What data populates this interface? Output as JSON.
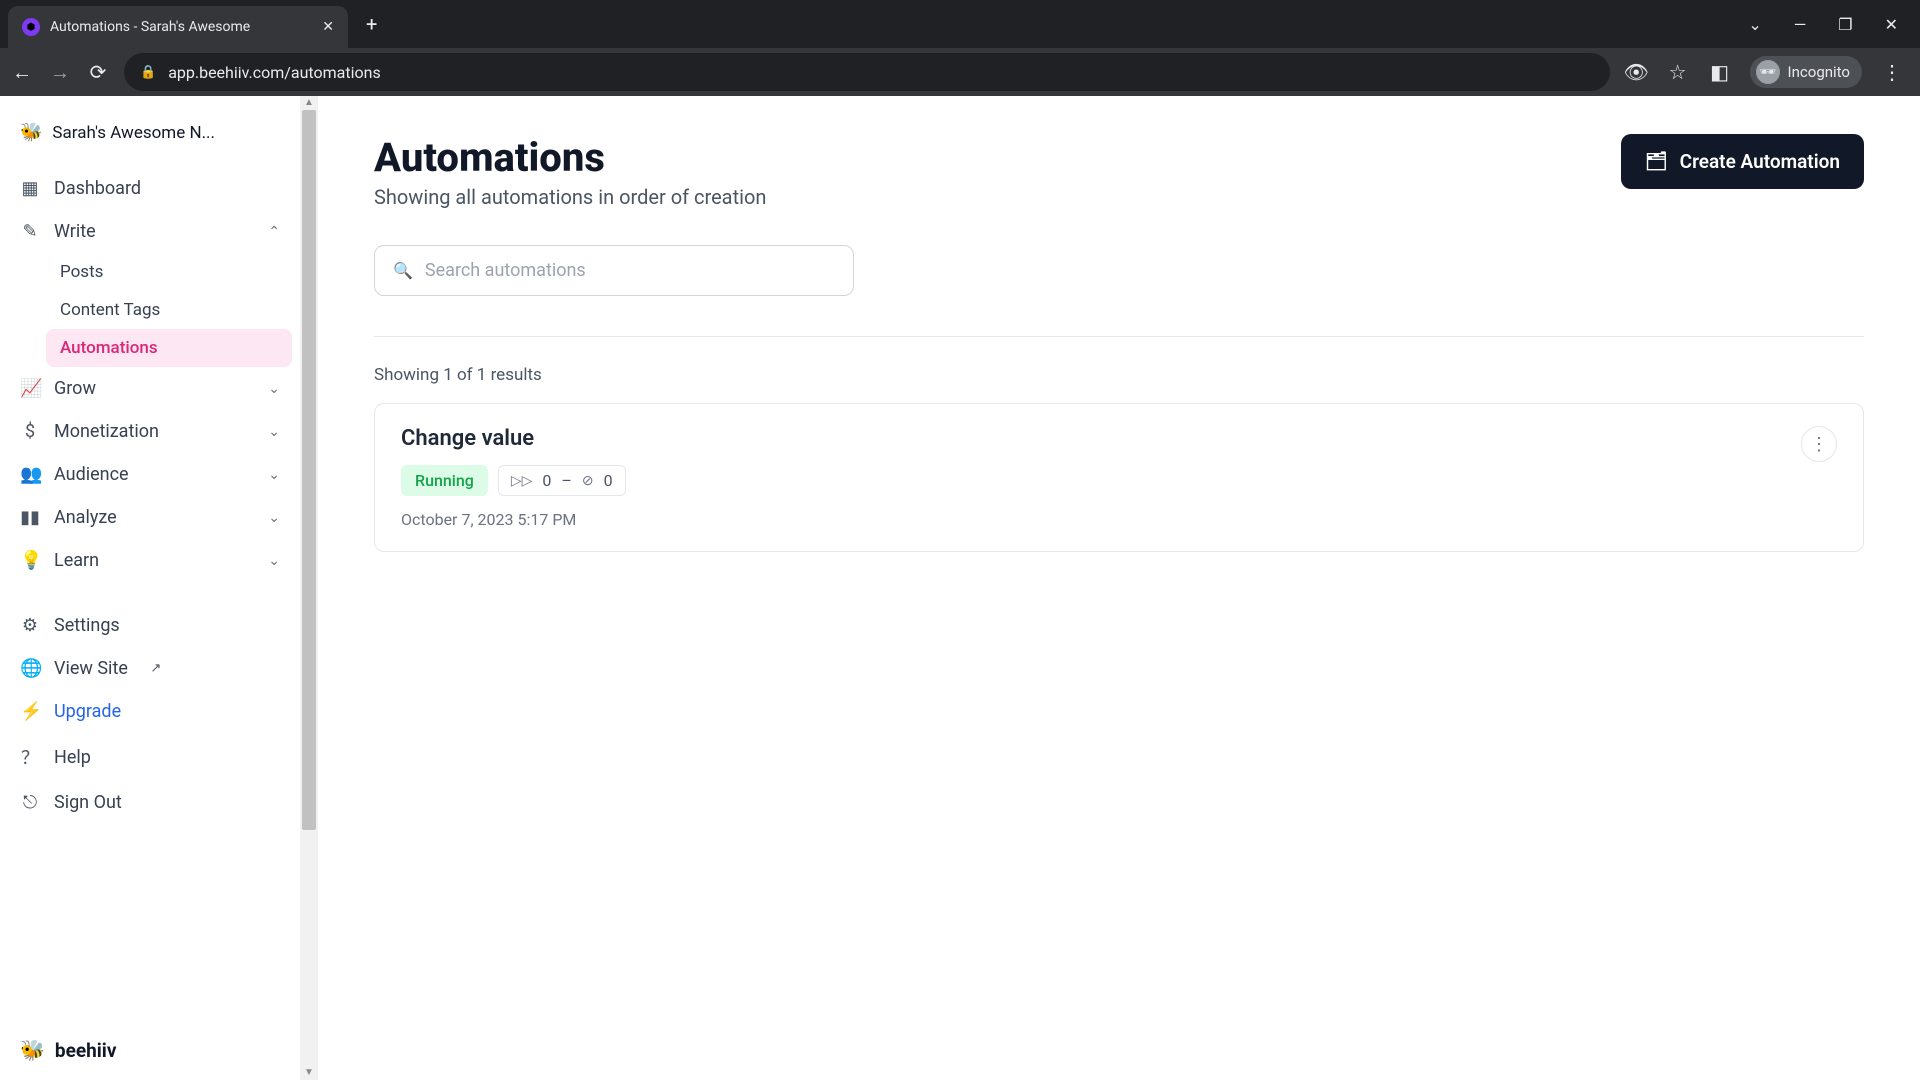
{
  "browser": {
    "tab_title": "Automations - Sarah's Awesome",
    "url": "app.beehiiv.com/automations",
    "incognito_label": "Incognito"
  },
  "sidebar": {
    "workspace_name": "Sarah's Awesome N...",
    "items": {
      "dashboard": "Dashboard",
      "write": "Write",
      "write_sub": {
        "posts": "Posts",
        "content_tags": "Content Tags",
        "automations": "Automations"
      },
      "grow": "Grow",
      "monetization": "Monetization",
      "audience": "Audience",
      "analyze": "Analyze",
      "learn": "Learn",
      "settings": "Settings",
      "view_site": "View Site",
      "upgrade": "Upgrade",
      "help": "Help",
      "sign_out": "Sign Out"
    },
    "brand": "beehiiv"
  },
  "main": {
    "title": "Automations",
    "subtitle": "Showing all automations in order of creation",
    "create_button": "Create Automation",
    "search_placeholder": "Search automations",
    "results_text": "Showing 1 of 1 results",
    "automation": {
      "name": "Change value",
      "status": "Running",
      "run_count": "0",
      "done_count": "0",
      "separator": "–",
      "date": "October 7, 2023 5:17 PM"
    }
  }
}
